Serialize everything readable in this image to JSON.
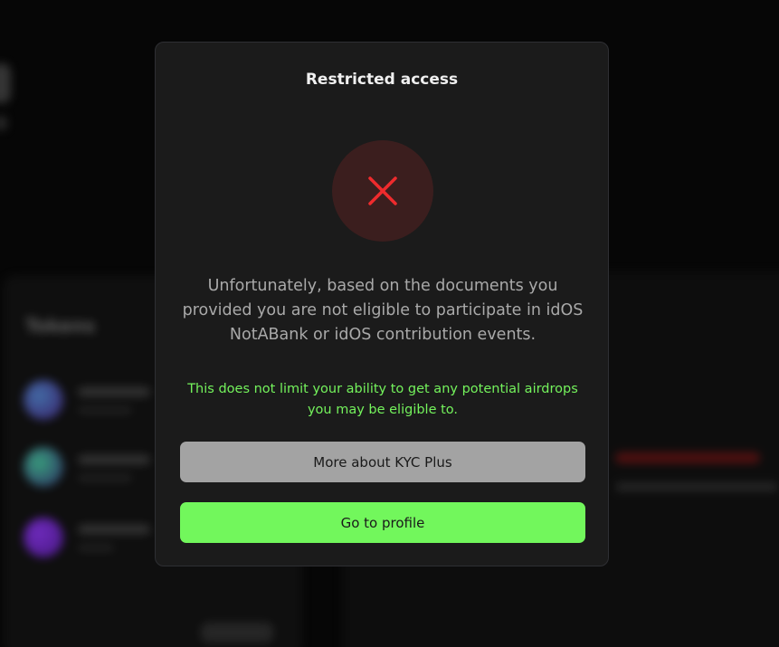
{
  "background": {
    "tokens_title": "Tokens"
  },
  "modal": {
    "title": "Restricted access",
    "icon": "close-x-icon",
    "message": "Unfortunately, based on the documents you provided you are not eligible to participate in idOS NotABank or idOS contribution events.",
    "note": "This does not limit your ability to get any potential airdrops you may be eligible to.",
    "kyc_button_label": "More about KYC Plus",
    "profile_button_label": "Go to profile"
  },
  "colors": {
    "accent_green": "#72f75c",
    "error_red": "#ef2b2d",
    "error_circle_bg": "#3b1e1e",
    "modal_bg": "#1b1b1b"
  }
}
